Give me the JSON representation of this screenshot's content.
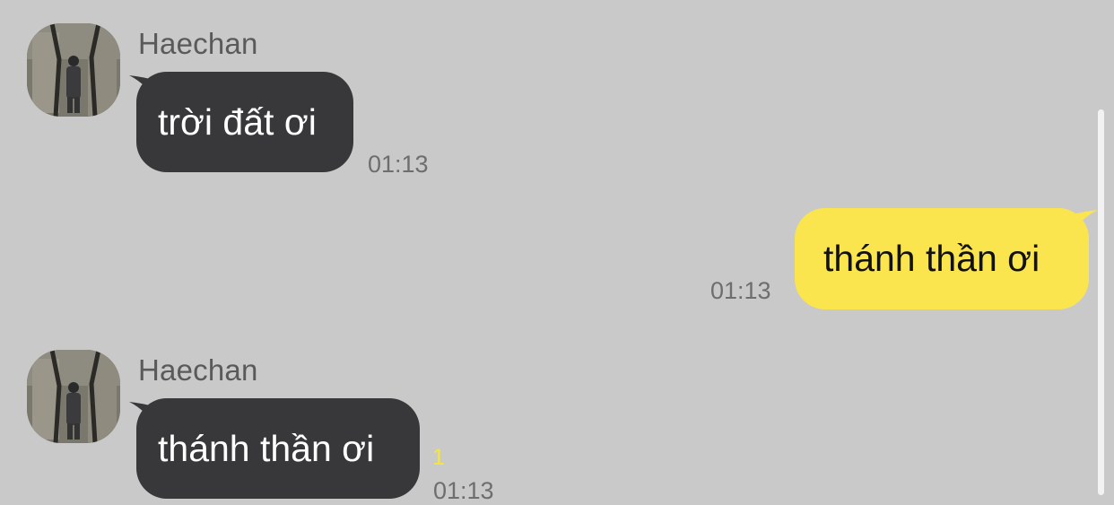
{
  "colors": {
    "background": "#c9c9c9",
    "incoming_bubble": "#38383b",
    "outgoing_bubble": "#fae54f",
    "unread_count": "#f7e53c"
  },
  "messages": [
    {
      "direction": "incoming",
      "sender": "Haechan",
      "text": "trời đất ơi",
      "time": "01:13"
    },
    {
      "direction": "outgoing",
      "text": "thánh thần ơi",
      "time": "01:13"
    },
    {
      "direction": "incoming",
      "sender": "Haechan",
      "text": "thánh thần ơi",
      "time": "01:13",
      "unread_count": "1"
    }
  ]
}
